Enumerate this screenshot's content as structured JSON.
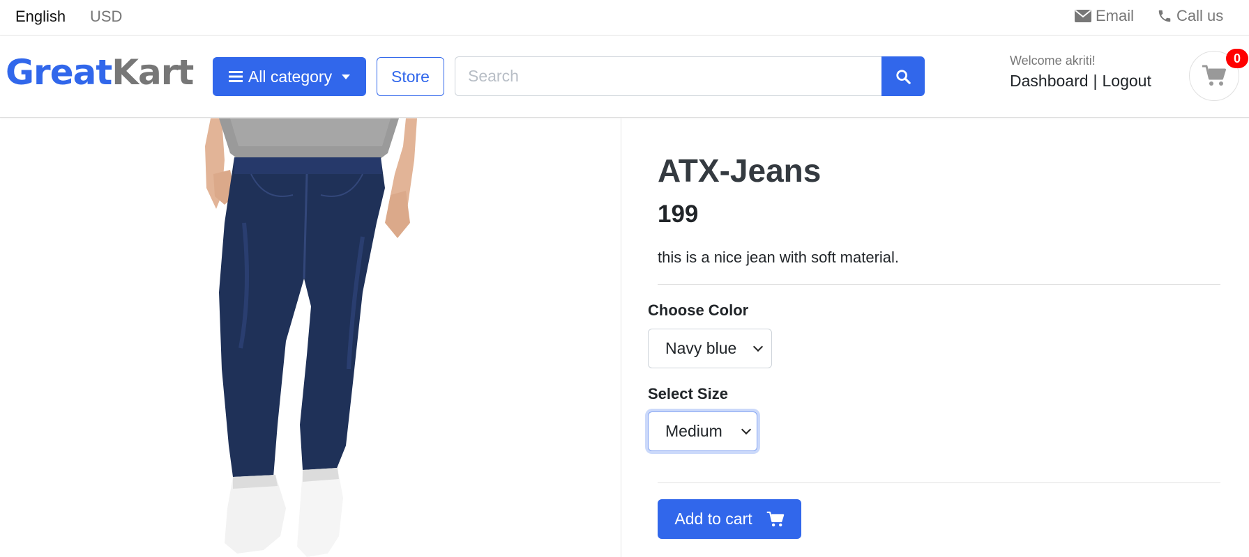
{
  "topbar": {
    "language": "English",
    "currency": "USD",
    "email_label": "Email",
    "call_label": "Call us"
  },
  "header": {
    "logo_part1": "Great",
    "logo_part2": "Kart",
    "all_category_label": "All category",
    "store_label": "Store",
    "search_placeholder": "Search",
    "welcome_text": "Welcome akriti!",
    "dashboard_label": "Dashboard",
    "separator": "|",
    "logout_label": "Logout",
    "cart_count": "0"
  },
  "product": {
    "name": "ATX-Jeans",
    "price": "199",
    "description": "this is a nice jean with soft material.",
    "color_label": "Choose Color",
    "color_selected": "Navy blue",
    "size_label": "Select Size",
    "size_selected": "Medium",
    "add_to_cart_label": "Add to cart"
  },
  "colors": {
    "primary": "#3167eb",
    "badge": "#ff0000",
    "jeans": "#1f3158"
  }
}
